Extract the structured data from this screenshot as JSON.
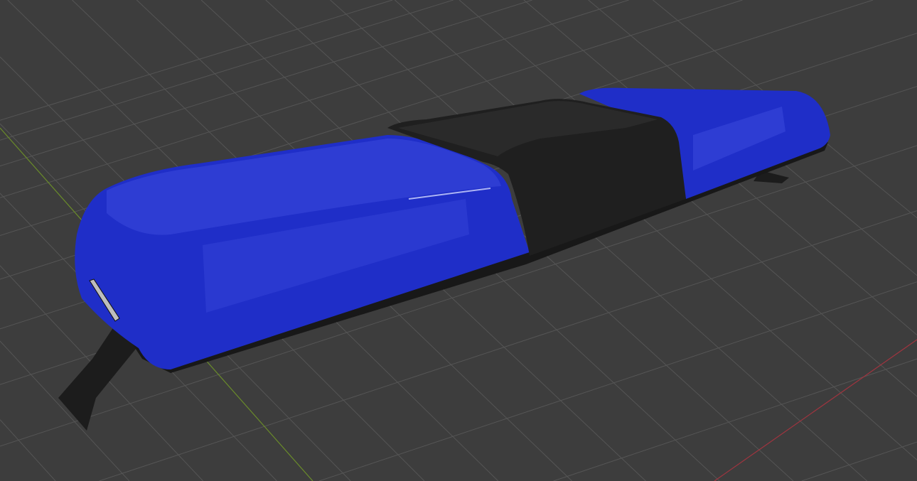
{
  "viewport": {
    "background_color": "#3d3d3d",
    "grid_color": "#555555",
    "x_axis_color": "#a0343f",
    "y_axis_color": "#6a8c2a"
  },
  "model": {
    "lens_color": "#1f2ec8",
    "lens_highlight_color": "#4a5ae8",
    "housing_color": "#1f1f1f"
  }
}
